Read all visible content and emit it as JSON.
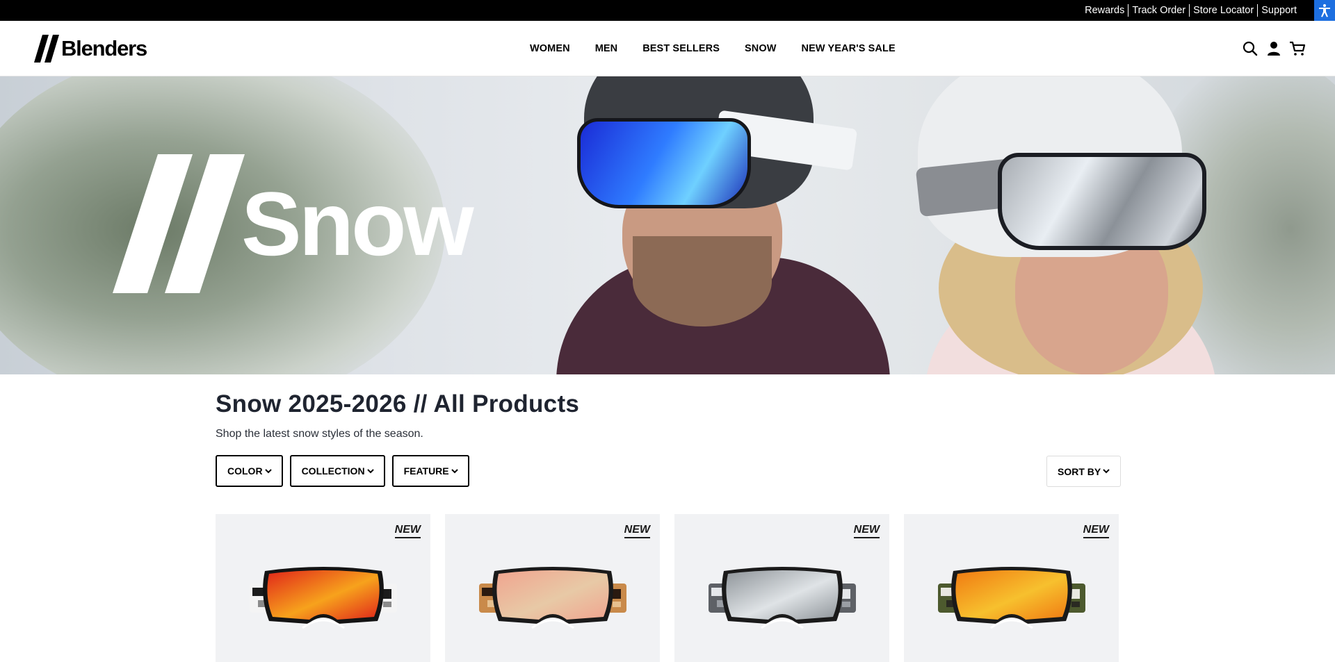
{
  "utility_bar": {
    "links": [
      "Rewards",
      "Track Order",
      "Store Locator",
      "Support"
    ],
    "accessibility_icon": "accessibility-icon"
  },
  "header": {
    "logo_text": "Blenders",
    "nav": [
      "WOMEN",
      "MEN",
      "BEST SELLERS",
      "SNOW",
      "NEW YEAR'S SALE"
    ],
    "icons": [
      "search-icon",
      "account-icon",
      "cart-icon"
    ]
  },
  "hero": {
    "word": "Snow"
  },
  "collection": {
    "title": "Snow 2025-2026 // All Products",
    "description": "Shop the latest snow styles of the season."
  },
  "filters": {
    "options": [
      "COLOR",
      "COLLECTION",
      "FEATURE"
    ],
    "sort_label": "SORT BY"
  },
  "products": [
    {
      "badge": "NEW",
      "lens_color": "#e0261a",
      "lens_color_2": "#f7a21c",
      "frame_color": "#141414",
      "strap": "camo"
    },
    {
      "badge": "NEW",
      "lens_color": "#f0a48f",
      "lens_color_2": "#e8c9a6",
      "frame_color": "#1a1a1a",
      "strap": "leopard"
    },
    {
      "badge": "NEW",
      "lens_color": "#8e9499",
      "lens_color_2": "#dfe3e6",
      "frame_color": "#1a1a1a",
      "strap": "grey"
    },
    {
      "badge": "NEW",
      "lens_color": "#f07a12",
      "lens_color_2": "#f7c02e",
      "frame_color": "#1a1a1a",
      "strap": "olive-camo"
    }
  ],
  "colors": {
    "utility_bar": "#000000",
    "accessibility_button": "#1d6fe0",
    "title_text": "#1f2430",
    "card_background": "#f1f2f4"
  }
}
